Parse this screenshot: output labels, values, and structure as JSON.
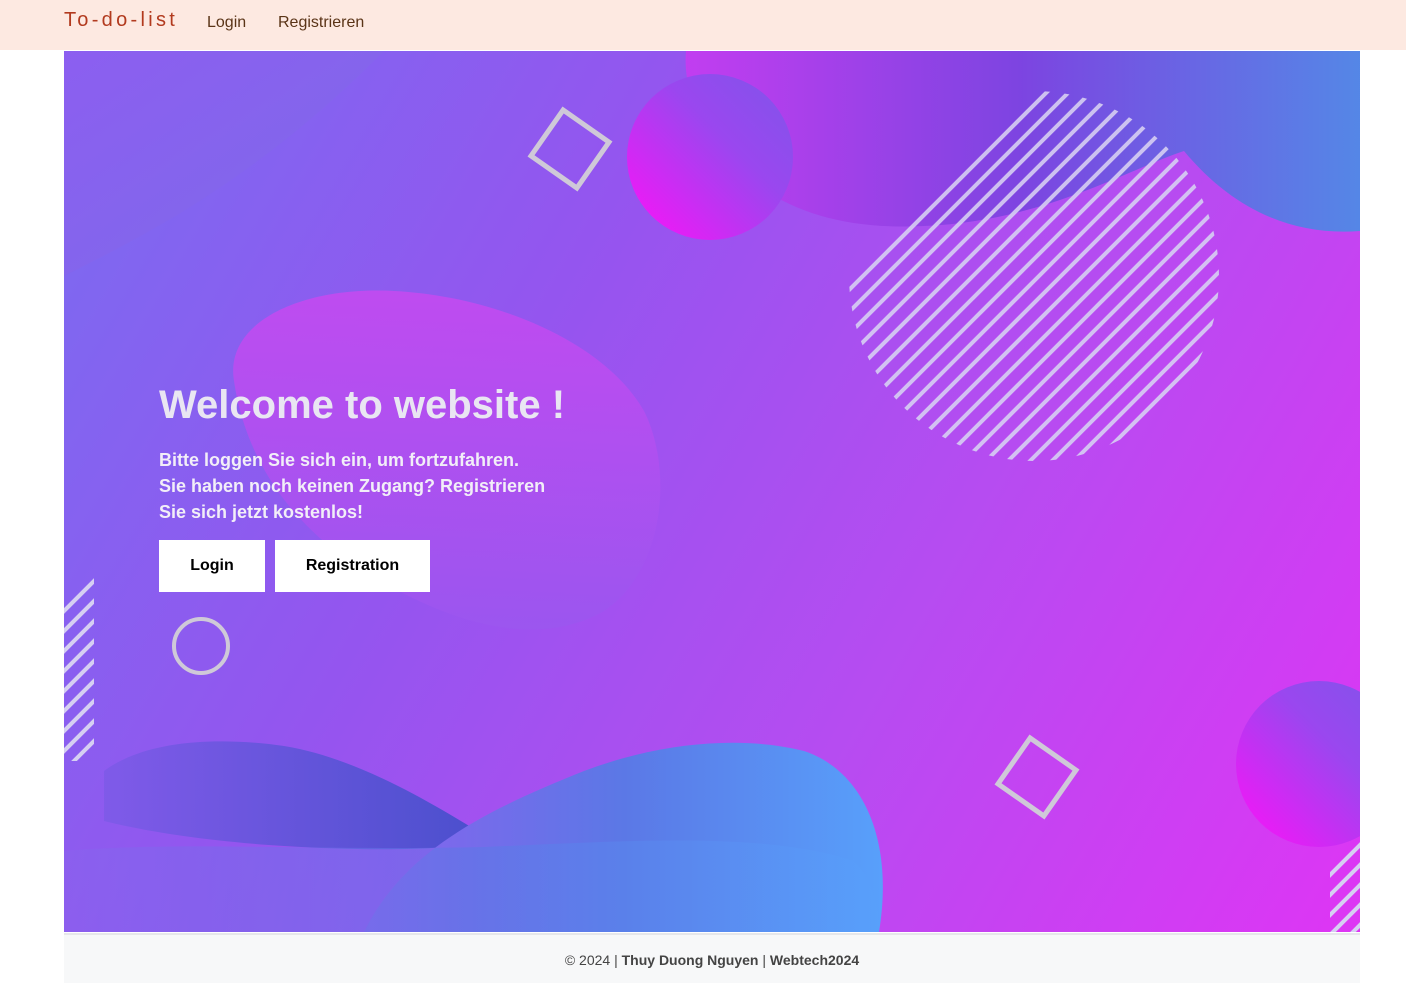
{
  "navbar": {
    "brand": "To-do-list",
    "links": [
      {
        "label": "Login"
      },
      {
        "label": "Registrieren"
      }
    ]
  },
  "hero": {
    "title": "Welcome to website !",
    "lines": [
      "Bitte loggen Sie sich ein, um fortzufahren.",
      "Sie haben noch keinen Zugang? Registrieren",
      "Sie sich jetzt kostenlos!"
    ],
    "buttons": {
      "login": "Login",
      "registration": "Registration"
    }
  },
  "footer": {
    "prefix": "© 2024 |",
    "author": "Thuy Duong Nguyen",
    "separator": "|",
    "project": "Webtech2024"
  },
  "colors": {
    "navbar_bg": "#fde9e1",
    "brand": "#b23a1e",
    "hero_gradient_start": "#7a6cf0",
    "hero_gradient_end": "#de35f4",
    "footer_bg": "#f7f8f9"
  }
}
